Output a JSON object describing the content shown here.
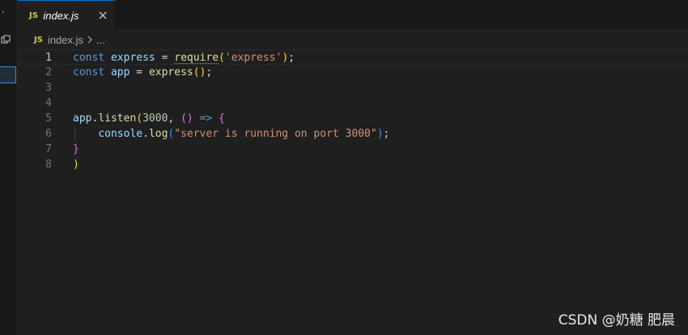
{
  "tab": {
    "icon_label": "JS",
    "filename": "index.js"
  },
  "breadcrumb": {
    "icon_label": "JS",
    "file": "index.js",
    "more": "..."
  },
  "editor": {
    "line_numbers": [
      "1",
      "2",
      "3",
      "4",
      "5",
      "6",
      "7",
      "8"
    ],
    "lines": [
      {
        "tokens": [
          [
            "kw",
            "const"
          ],
          [
            "op",
            " "
          ],
          [
            "var",
            "express"
          ],
          [
            "op",
            " = "
          ],
          [
            "fn req",
            "require"
          ],
          [
            "p1",
            "("
          ],
          [
            "str",
            "'express'"
          ],
          [
            "p1",
            ")"
          ],
          [
            "op",
            ";"
          ]
        ]
      },
      {
        "tokens": [
          [
            "kw",
            "const"
          ],
          [
            "op",
            " "
          ],
          [
            "var",
            "app"
          ],
          [
            "op",
            " = "
          ],
          [
            "fn",
            "express"
          ],
          [
            "p1",
            "()"
          ],
          [
            "op",
            ";"
          ]
        ]
      },
      {
        "tokens": []
      },
      {
        "tokens": []
      },
      {
        "tokens": [
          [
            "var",
            "app"
          ],
          [
            "op",
            "."
          ],
          [
            "fn",
            "listen"
          ],
          [
            "p1",
            "("
          ],
          [
            "num",
            "3000"
          ],
          [
            "op",
            ", "
          ],
          [
            "p2",
            "()"
          ],
          [
            "op",
            " "
          ],
          [
            "kw",
            "=>"
          ],
          [
            "op",
            " "
          ],
          [
            "p2",
            "{"
          ]
        ]
      },
      {
        "tokens": [
          [
            "op",
            "    "
          ],
          [
            "var",
            "console"
          ],
          [
            "op",
            "."
          ],
          [
            "fn",
            "log"
          ],
          [
            "p3",
            "("
          ],
          [
            "str",
            "\"server is running on port 3000\""
          ],
          [
            "p3",
            ")"
          ],
          [
            "op",
            ";"
          ]
        ]
      },
      {
        "tokens": [
          [
            "p2",
            "}"
          ]
        ]
      },
      {
        "tokens": [
          [
            "p1",
            ")"
          ]
        ]
      }
    ]
  },
  "watermark": "CSDN @奶糖 肥晨",
  "icons": {
    "close": "close-icon",
    "chevron": "chevron-right-icon",
    "split": "split-editor-icon"
  }
}
